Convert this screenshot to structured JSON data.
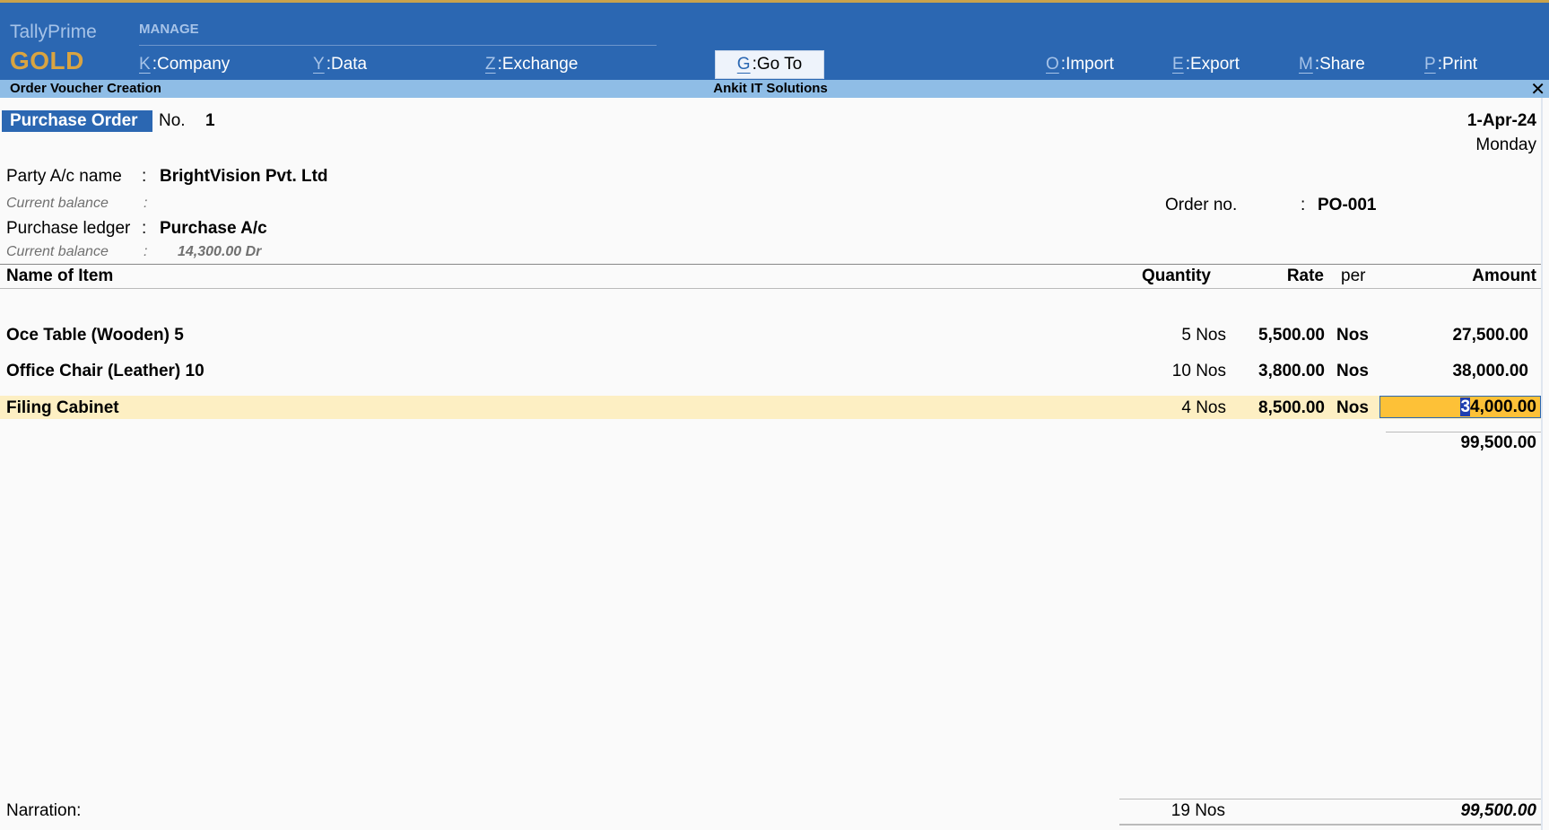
{
  "app": {
    "name": "TallyPrime",
    "edition": "GOLD"
  },
  "menu": {
    "group_label": "MANAGE",
    "items": [
      {
        "key": "K",
        "label": "Company"
      },
      {
        "key": "Y",
        "label": "Data"
      },
      {
        "key": "Z",
        "label": "Exchange"
      },
      {
        "key": "G",
        "label": "Go To"
      },
      {
        "key": "O",
        "label": "Import"
      },
      {
        "key": "E",
        "label": "Export"
      },
      {
        "key": "M",
        "label": "Share"
      },
      {
        "key": "P",
        "label": "Print"
      }
    ]
  },
  "titlebar": {
    "screen": "Order Voucher Creation",
    "company": "Ankit IT Solutions",
    "close_glyph": "✕"
  },
  "voucher": {
    "type": "Purchase Order",
    "no_label": "No.",
    "no": "1",
    "date": "1-Apr-24",
    "day": "Monday",
    "party_label": "Party A/c name",
    "party": "BrightVision Pvt. Ltd",
    "cur_bal_label": "Current balance",
    "party_balance": "",
    "ledger_label": "Purchase ledger",
    "ledger": "Purchase A/c",
    "ledger_balance": "14,300.00 Dr",
    "order_no_label": "Order no.",
    "order_no": "PO-001",
    "colon": ":"
  },
  "table": {
    "headers": {
      "name": "Name of Item",
      "qty": "Quantity",
      "rate": "Rate",
      "per": "per",
      "amount": "Amount"
    },
    "rows": [
      {
        "name": "Oce Table (Wooden) 5",
        "qty": "5 Nos",
        "rate": "5,500.00",
        "per": "Nos",
        "amount": "27,500.00"
      },
      {
        "name": "Office Chair (Leather) 10",
        "qty": "10 Nos",
        "rate": "3,800.00",
        "per": "Nos",
        "amount": "38,000.00"
      },
      {
        "name": "Filing Cabinet",
        "qty": "4 Nos",
        "rate": "8,500.00",
        "per": "Nos",
        "amount_first_char": "3",
        "amount_rest": "4,000.00"
      }
    ],
    "subtotal": "99,500.00"
  },
  "footer": {
    "narration_label": "Narration:",
    "total_qty": "19 Nos",
    "total_amount": "99,500.00"
  },
  "colors": {
    "menu_bg": "#2b67b2",
    "title_bg": "#8fbde6",
    "edition": "#d9a441",
    "selected_row": "#fdefc3",
    "active_field": "#fdc137"
  }
}
